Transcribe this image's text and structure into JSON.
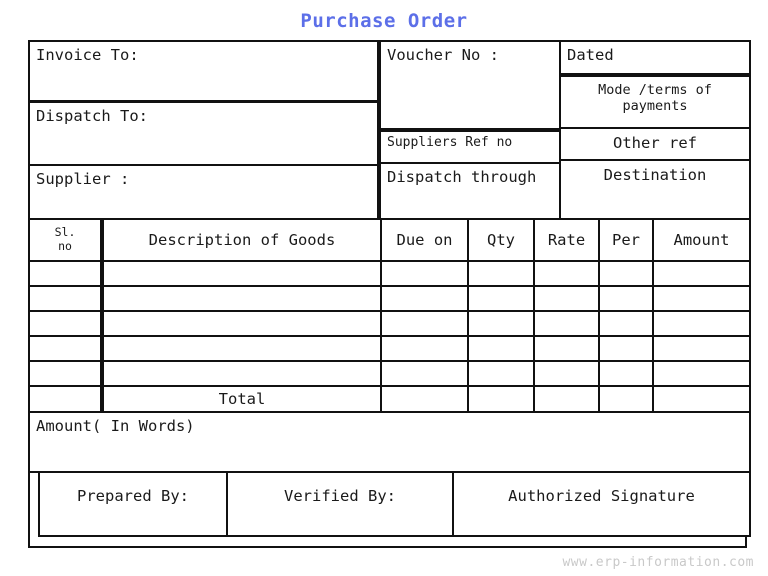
{
  "document": {
    "title": "Purchase Order",
    "title_color": "#5c6fe8",
    "watermark": "www.erp-information.com"
  },
  "header": {
    "left": {
      "invoice_to": "Invoice To:",
      "dispatch_to": "Dispatch To:",
      "supplier": "Supplier :"
    },
    "right": {
      "voucher_no": "Voucher No :",
      "dated": "Dated",
      "mode_terms": "Mode /terms of\npayments",
      "suppliers_ref_no": "Suppliers Ref no",
      "other_ref": "Other ref",
      "dispatch_through": "Dispatch through",
      "destination": "Destination"
    }
  },
  "items_table": {
    "columns": [
      {
        "key": "sl_no",
        "label": "Sl.\nno"
      },
      {
        "key": "description",
        "label": "Description of Goods"
      },
      {
        "key": "due_on",
        "label": "Due on"
      },
      {
        "key": "qty",
        "label": "Qty"
      },
      {
        "key": "rate",
        "label": "Rate"
      },
      {
        "key": "per",
        "label": "Per"
      },
      {
        "key": "amount",
        "label": "Amount"
      }
    ],
    "rows": [
      {
        "sl_no": "",
        "description": "",
        "due_on": "",
        "qty": "",
        "rate": "",
        "per": "",
        "amount": ""
      },
      {
        "sl_no": "",
        "description": "",
        "due_on": "",
        "qty": "",
        "rate": "",
        "per": "",
        "amount": ""
      },
      {
        "sl_no": "",
        "description": "",
        "due_on": "",
        "qty": "",
        "rate": "",
        "per": "",
        "amount": ""
      },
      {
        "sl_no": "",
        "description": "",
        "due_on": "",
        "qty": "",
        "rate": "",
        "per": "",
        "amount": ""
      },
      {
        "sl_no": "",
        "description": "",
        "due_on": "",
        "qty": "",
        "rate": "",
        "per": "",
        "amount": ""
      }
    ],
    "total_row": {
      "sl_no": "",
      "label": "Total",
      "due_on": "",
      "qty": "",
      "rate": "",
      "per": "",
      "amount": ""
    }
  },
  "footer": {
    "amount_in_words": "Amount( In Words)",
    "prepared_by": "Prepared By:",
    "verified_by": "Verified By:",
    "authorized_signature": "Authorized Signature"
  }
}
